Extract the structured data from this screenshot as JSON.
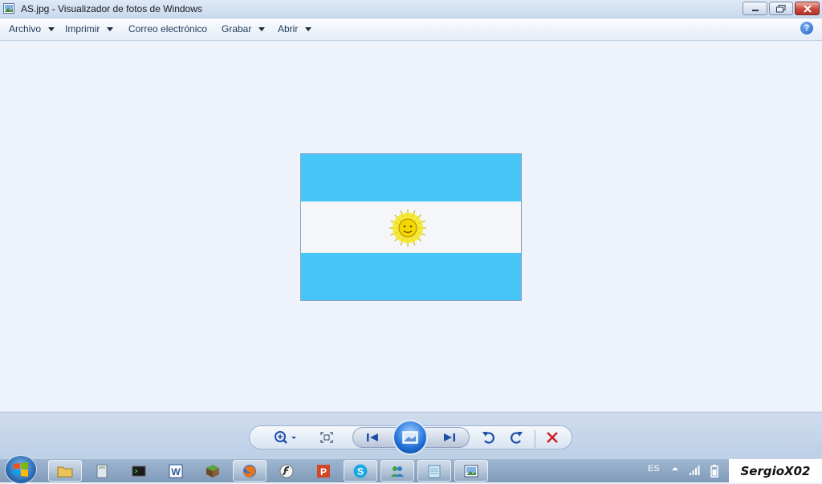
{
  "window": {
    "title": "AS.jpg - Visualizador de fotos de Windows",
    "app_icon": "photo-viewer-icon",
    "buttons": [
      "minimize-icon",
      "maximize-icon",
      "close-icon"
    ]
  },
  "menu": {
    "items": [
      {
        "label": "Archivo",
        "dropdown": true
      },
      {
        "label": "Imprimir",
        "dropdown": true
      },
      {
        "label": "Correo electrónico",
        "dropdown": false
      },
      {
        "label": "Grabar",
        "dropdown": true
      },
      {
        "label": "Abrir",
        "dropdown": true
      }
    ],
    "help_label": "?"
  },
  "image": {
    "file": "AS.jpg",
    "colors": {
      "sky_blue": "#45c6f6",
      "white": "#f5f6f8",
      "sun": "#f3e21a"
    }
  },
  "controls": {
    "icons": [
      "zoom-icon",
      "fit-to-window-icon",
      "previous-icon",
      "slideshow-icon",
      "next-icon",
      "rotate-counterclockwise-icon",
      "rotate-clockwise-icon",
      "delete-icon"
    ]
  },
  "taskbar": {
    "icons": [
      "start-orb-icon",
      "explorer-icon",
      "calculator-icon",
      "terminal-icon",
      "word-icon",
      "minecraft-icon",
      "firefox-icon",
      "flash-icon",
      "powerpoint-icon",
      "skype-icon",
      "users-icon",
      "notepad-icon",
      "photo-viewer-icon"
    ],
    "language": "ES",
    "watermark": "SergioX02"
  }
}
